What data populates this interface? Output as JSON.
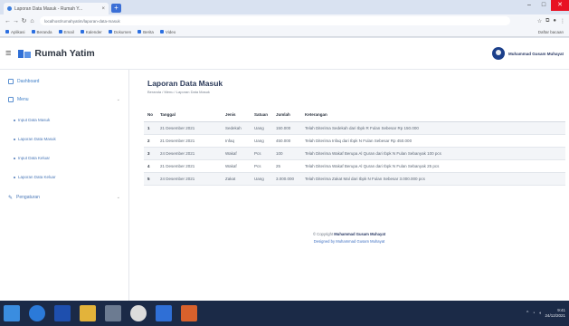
{
  "browser": {
    "tab_title": "Laporan Data Masuk - Rumah Y...",
    "tab_close": "×",
    "new_tab": "+",
    "url": "localhost/rumahyatim/laporan-data-masuk",
    "bookmarks": [
      "Aplikasi",
      "Beranda",
      "Email",
      "Kalender",
      "Dokumen",
      "Berita",
      "Video"
    ],
    "bookmarks_right": "Daftar bacaan"
  },
  "app": {
    "brand": "Rumah Yatim",
    "user_name": "Muhammad Gusam Muhayat"
  },
  "sidebar": {
    "dashboard": "Dashboard",
    "menu": "Menu",
    "sub_items": [
      "Input Data Masuk",
      "Laporan Data Masuk",
      "Input Data Keluar",
      "Laporan Data Keluar"
    ],
    "pengaturan": "Pengaturan"
  },
  "page": {
    "title": "Laporan Data Masuk",
    "breadcrumb": "Beranda  /  Menu  /  Laporan Data Masuk"
  },
  "table": {
    "headers": [
      "No",
      "Tanggal",
      "Jenis",
      "Satuan",
      "Jumlah",
      "Keterangan"
    ],
    "rows": [
      [
        "1",
        "21 Desember 2021",
        "Sedekah",
        "Uang",
        "150.000",
        "Telah Diterima Sedekah dari Ibpk R Fulan Sebesar Rp 150.000"
      ],
      [
        "2",
        "21 Desember 2021",
        "Infaq",
        "Uang",
        "450.000",
        "Telah Diterima Infaq dari Ibpk N Fulan Sebesar Rp 450.000"
      ],
      [
        "3",
        "24 Desember 2021",
        "Wakaf",
        "Pcs",
        "100",
        "Telah Diterima Wakaf Berupa Al Quran dari Ibpk N Fulan Sebanyak 100 pcs"
      ],
      [
        "4",
        "21 Desember 2021",
        "Wakaf",
        "Pcs",
        "25",
        "Telah Diterima Wakaf Berupa Al Quran dari Ibpk N Fulan Sebanyak 25 pcs"
      ],
      [
        "5",
        "24 Desember 2021",
        "Zakat",
        "Uang",
        "3.000.000",
        "Telah Diterima Zakat Mal dari Ibpk N Fulan Sebesar 3.000.000 pcs"
      ]
    ]
  },
  "footer": {
    "copyright": "© Copyright",
    "owner": "Muhammad Gusam Muhayat",
    "designed": "Designed by Muhammad Gusam Muhayat"
  },
  "taskbar": {
    "time": "9:41",
    "date": "24/12/2021"
  }
}
